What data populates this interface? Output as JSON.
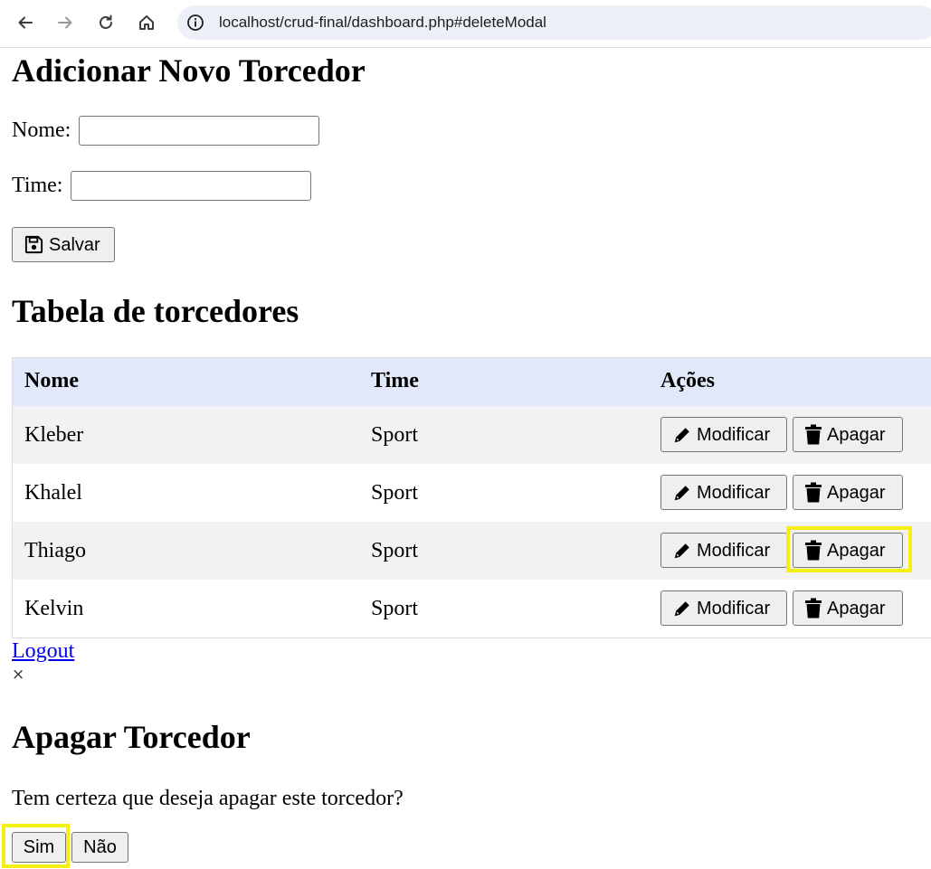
{
  "browser": {
    "url": "localhost/crud-final/dashboard.php#deleteModal",
    "icons": [
      "back-icon",
      "forward-icon",
      "reload-icon",
      "home-icon",
      "site-info-icon"
    ]
  },
  "add_form": {
    "heading": "Adicionar Novo Torcedor",
    "name_label": "Nome:",
    "name_value": "",
    "team_label": "Time:",
    "team_value": "",
    "save_label": "Salvar",
    "save_icon": "floppy-disk-icon"
  },
  "table": {
    "heading": "Tabela de torcedores",
    "columns": [
      "Nome",
      "Time",
      "Ações"
    ],
    "rows": [
      {
        "name": "Kleber",
        "team": "Sport"
      },
      {
        "name": "Khalel",
        "team": "Sport"
      },
      {
        "name": "Thiago",
        "team": "Sport"
      },
      {
        "name": "Kelvin",
        "team": "Sport"
      }
    ],
    "edit_label": "Modificar",
    "edit_icon": "pencil-icon",
    "delete_label": "Apagar",
    "delete_icon": "trash-icon"
  },
  "logout_label": "Logout",
  "modal": {
    "close_symbol": "×",
    "heading": "Apagar Torcedor",
    "message": "Tem certeza que deseja apagar este torcedor?",
    "yes_label": "Sim",
    "no_label": "Não"
  },
  "colors": {
    "table_header_bg": "#e0e8fa",
    "row_stripe_bg": "#f2f2f2",
    "highlight": "#f5ef12",
    "link": "#0000ee"
  }
}
